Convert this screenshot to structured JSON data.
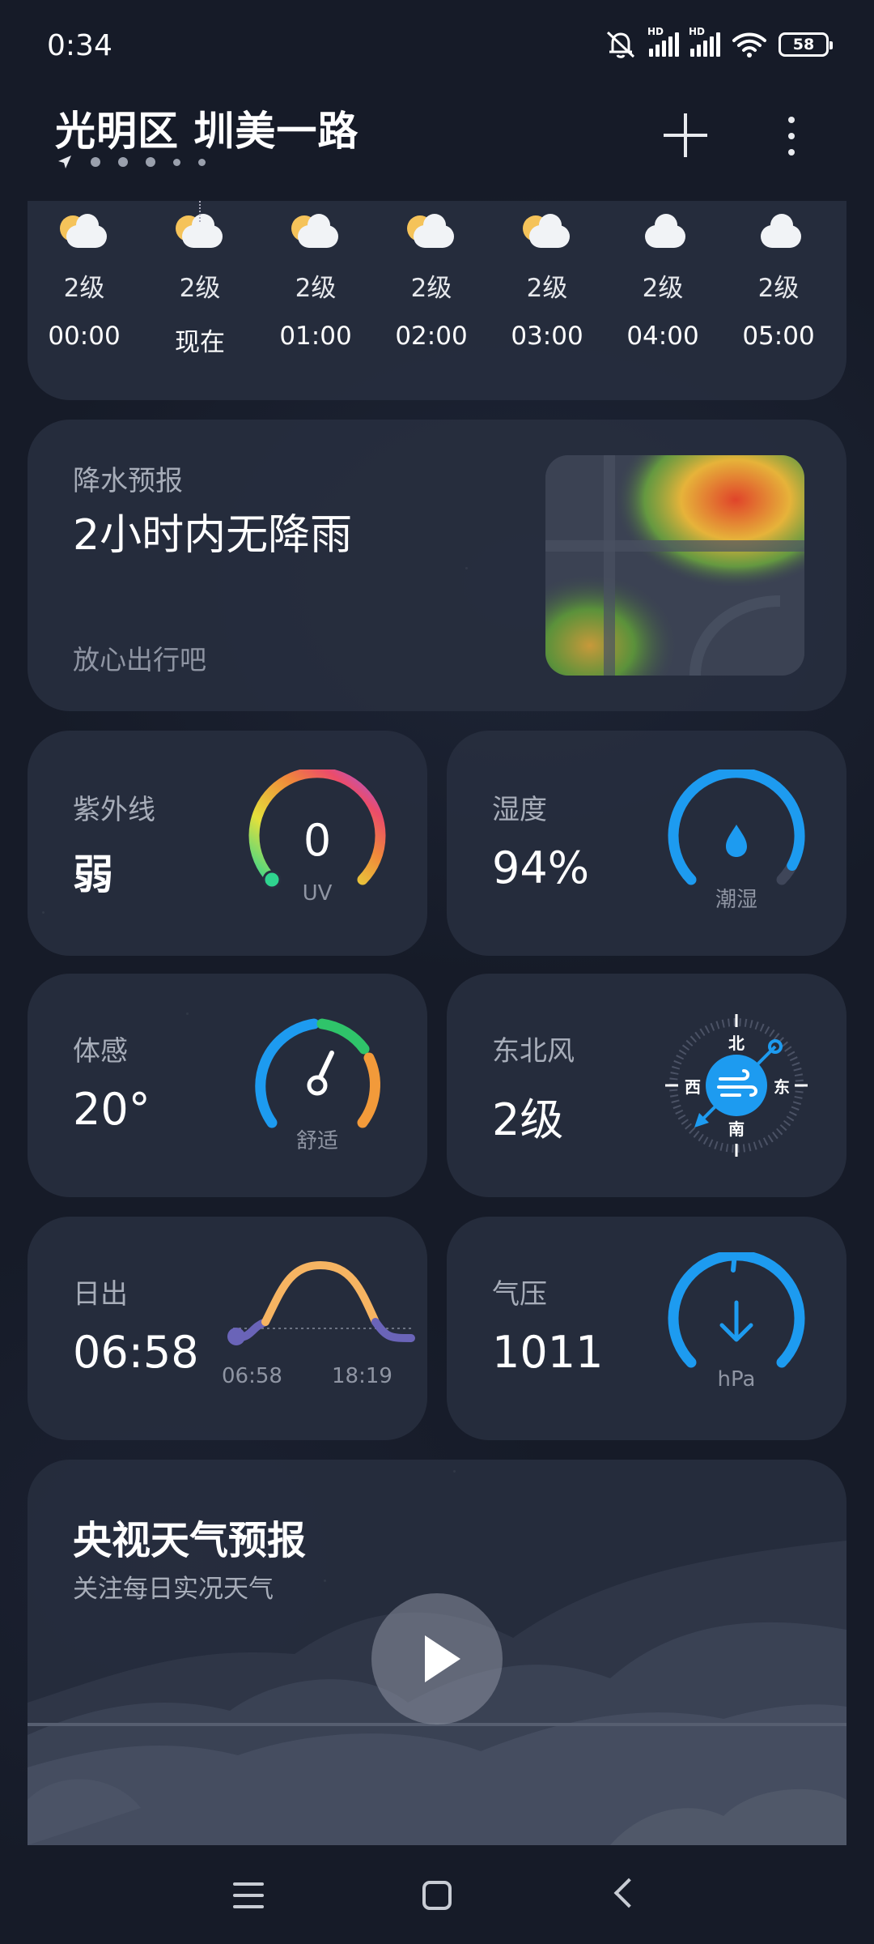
{
  "status_bar": {
    "time": "0:34",
    "hd_label": "HD",
    "battery": "58"
  },
  "header": {
    "location": "光明区 圳美一路"
  },
  "hourly": [
    {
      "level": "2级",
      "time": "00:00",
      "icon": "moon-cloud-icon"
    },
    {
      "level": "2级",
      "time": "现在",
      "icon": "moon-cloud-icon"
    },
    {
      "level": "2级",
      "time": "01:00",
      "icon": "moon-cloud-icon"
    },
    {
      "level": "2级",
      "time": "02:00",
      "icon": "moon-cloud-icon"
    },
    {
      "level": "2级",
      "time": "03:00",
      "icon": "moon-cloud-icon"
    },
    {
      "level": "2级",
      "time": "04:00",
      "icon": "cloud-icon"
    },
    {
      "level": "2级",
      "time": "05:00",
      "icon": "cloud-icon"
    }
  ],
  "precip": {
    "label": "降水预报",
    "value": "2小时内无降雨",
    "sub": "放心出行吧"
  },
  "uv": {
    "label": "紫外线",
    "value": "弱",
    "gauge_value": "0",
    "gauge_unit": "UV"
  },
  "humidity": {
    "label": "湿度",
    "value": "94%",
    "gauge_text": "潮湿",
    "level": 0.94
  },
  "feels": {
    "label": "体感",
    "value": "20°",
    "gauge_text": "舒适"
  },
  "wind": {
    "label": "东北风",
    "value": "2级",
    "north": "北",
    "south": "南",
    "west": "西",
    "east": "东"
  },
  "sunrise": {
    "label": "日出",
    "value": "06:58",
    "rise_time": "06:58",
    "set_time": "18:19"
  },
  "pressure": {
    "label": "气压",
    "value": "1011",
    "unit": "hPa"
  },
  "video": {
    "title": "央视天气预报",
    "subtitle": "关注每日实况天气"
  },
  "colors": {
    "card_bg": "#282f40",
    "accent_blue": "#1d9bf0",
    "sun_orange": "#f6b462"
  }
}
